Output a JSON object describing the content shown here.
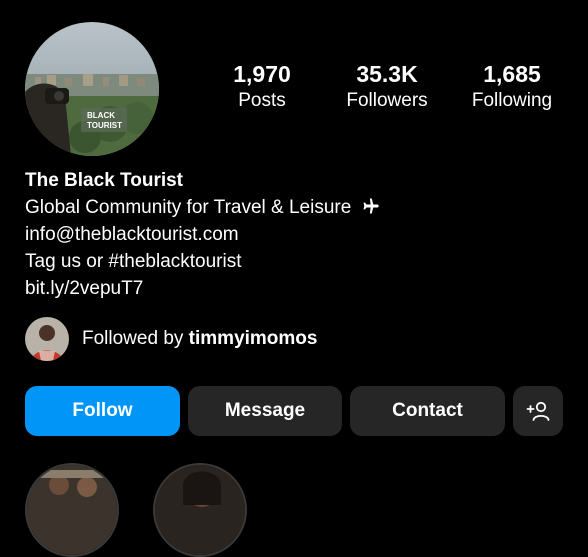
{
  "profile": {
    "watermark_line1": "BLACK",
    "watermark_line2": "TOURIST"
  },
  "stats": [
    {
      "value": "1,970",
      "label": "Posts"
    },
    {
      "value": "35.3K",
      "label": "Followers"
    },
    {
      "value": "1,685",
      "label": "Following"
    }
  ],
  "bio": {
    "name": "The Black Tourist",
    "line1": "Global Community for Travel & Leisure",
    "line1_icon": "airplane-icon",
    "email": "info@theblacktourist.com",
    "tagline": "Tag us or #theblacktourist",
    "link": "bit.ly/2vepuT7"
  },
  "followed_by": {
    "prefix": "Followed by",
    "username": "timmyimomos"
  },
  "actions": {
    "follow": "Follow",
    "message": "Message",
    "contact": "Contact",
    "suggest_icon": "add-person-icon"
  },
  "colors": {
    "background": "#000000",
    "primary_button": "#0095f6",
    "secondary_button": "#262626"
  }
}
